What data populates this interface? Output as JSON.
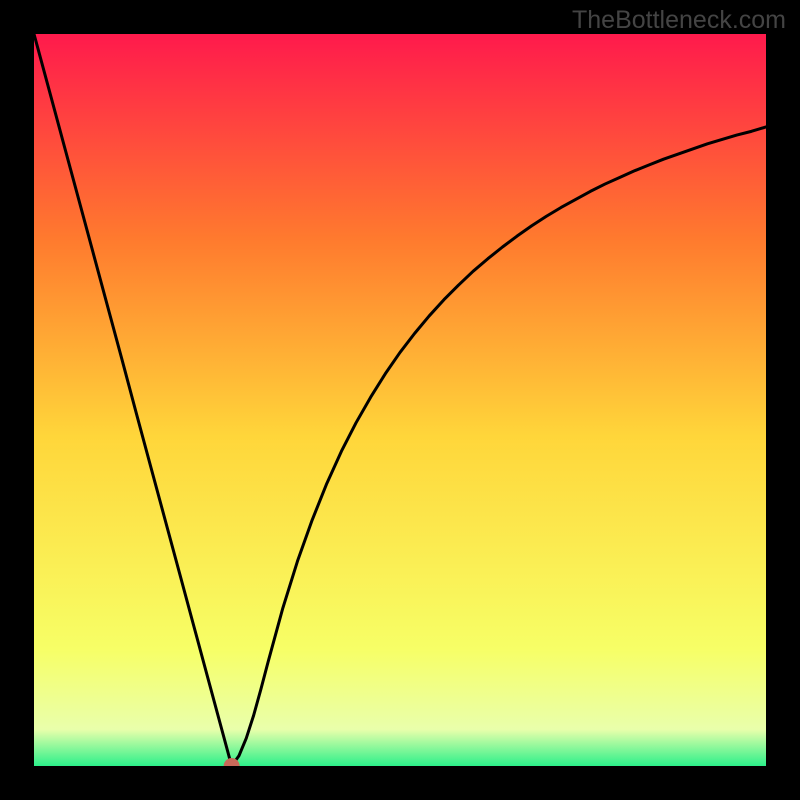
{
  "watermark": "TheBottleneck.com",
  "colors": {
    "top": "#ff1a4c",
    "mid_upper": "#ff7a2e",
    "mid": "#ffd63a",
    "mid_lower": "#f7ff66",
    "bottom": "#2cf08a",
    "curve": "#000000",
    "marker": "#c86a5a",
    "frame": "#000000"
  },
  "chart_data": {
    "type": "line",
    "title": "",
    "xlabel": "",
    "ylabel": "",
    "xlim": [
      0,
      100
    ],
    "ylim": [
      0,
      100
    ],
    "x": [
      0,
      2,
      4,
      6,
      8,
      10,
      12,
      14,
      16,
      18,
      20,
      22,
      24,
      26,
      27,
      28,
      29,
      30,
      31,
      32,
      34,
      36,
      38,
      40,
      42,
      44,
      46,
      48,
      50,
      52,
      54,
      56,
      58,
      60,
      62,
      64,
      66,
      68,
      70,
      72,
      74,
      76,
      78,
      80,
      82,
      84,
      86,
      88,
      90,
      92,
      94,
      96,
      98,
      100
    ],
    "values": [
      100,
      92.6,
      85.2,
      77.8,
      70.4,
      63.0,
      55.6,
      48.1,
      40.7,
      33.3,
      25.9,
      18.5,
      11.1,
      3.7,
      0.0,
      1.4,
      3.8,
      6.9,
      10.5,
      14.3,
      21.6,
      28.0,
      33.6,
      38.6,
      43.0,
      46.9,
      50.4,
      53.6,
      56.5,
      59.1,
      61.5,
      63.7,
      65.7,
      67.6,
      69.3,
      70.9,
      72.4,
      73.8,
      75.1,
      76.3,
      77.4,
      78.5,
      79.5,
      80.4,
      81.3,
      82.1,
      82.9,
      83.6,
      84.3,
      85.0,
      85.6,
      86.2,
      86.7,
      87.3
    ],
    "marker": {
      "x": 27,
      "y": 0
    }
  }
}
